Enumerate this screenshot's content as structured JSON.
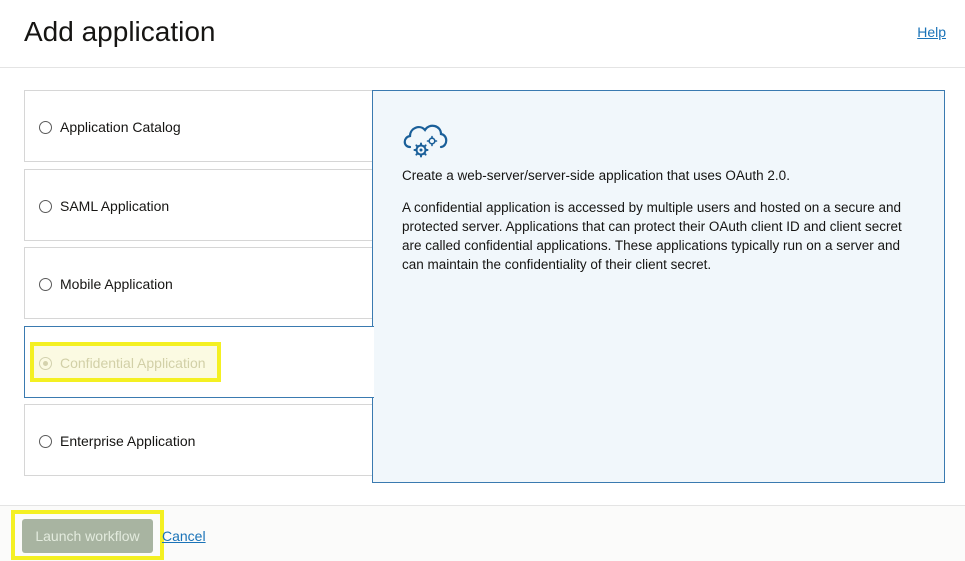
{
  "header": {
    "title": "Add application",
    "help_label": "Help"
  },
  "options": [
    {
      "label": "Application Catalog",
      "selected": false
    },
    {
      "label": "SAML Application",
      "selected": false
    },
    {
      "label": "Mobile Application",
      "selected": false
    },
    {
      "label": "Confidential Application",
      "selected": true
    },
    {
      "label": "Enterprise Application",
      "selected": false
    }
  ],
  "detail": {
    "icon": "cloud-gear-icon",
    "summary": "Create a web-server/server-side application that uses OAuth 2.0.",
    "description": "A confidential application is accessed by multiple users and hosted on a secure and protected server. Applications that can protect their OAuth client ID and client secret are called confidential applications. These applications typically run on a server and can maintain the confidentiality of their client secret."
  },
  "footer": {
    "launch_label": "Launch workflow",
    "cancel_label": "Cancel"
  },
  "colors": {
    "accent_border": "#3a7ab0",
    "link": "#1a73b8",
    "highlight": "#f4f022",
    "panel_bg": "#f1f7fb"
  }
}
